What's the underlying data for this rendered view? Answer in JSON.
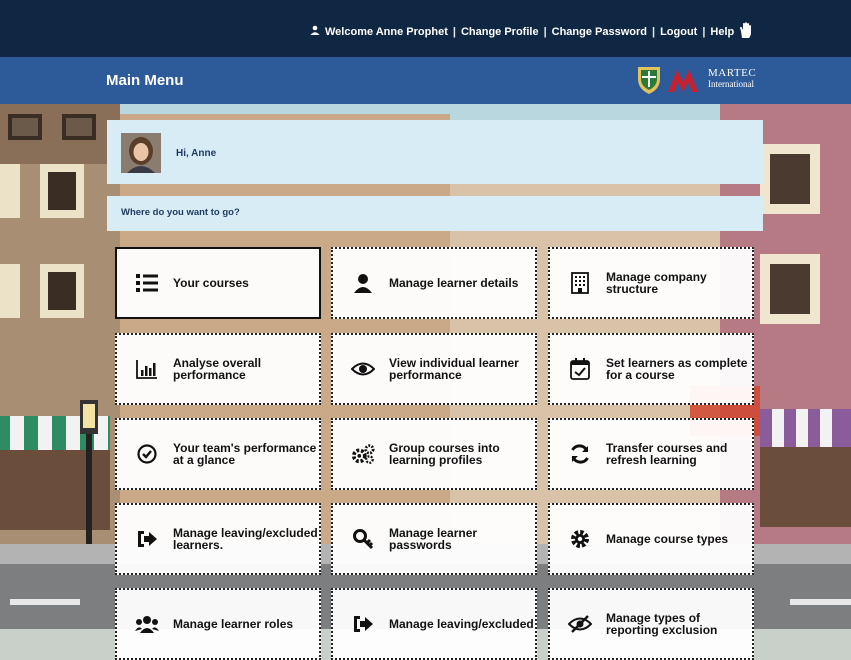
{
  "topbar": {
    "welcome": "Welcome Anne Prophet",
    "change_profile": "Change Profile",
    "change_password": "Change Password",
    "logout": "Logout",
    "help": "Help"
  },
  "header": {
    "title": "Main Menu",
    "brand_line1": "MARTEC",
    "brand_line2": "International"
  },
  "greeting": {
    "text": "Hi, Anne"
  },
  "prompt": {
    "text": "Where do you want to go?"
  },
  "tiles": [
    {
      "label": "Your courses",
      "icon": "list-icon"
    },
    {
      "label": "Manage learner details",
      "icon": "user-icon"
    },
    {
      "label": "Manage company structure",
      "icon": "building-icon"
    },
    {
      "label": "Analyse overall performance",
      "icon": "bar-chart-icon"
    },
    {
      "label": "View individual learner performance",
      "icon": "eye-icon"
    },
    {
      "label": "Set learners as complete for a course",
      "icon": "calendar-check-icon"
    },
    {
      "label": "Your team's performance at a glance",
      "icon": "check-circle-icon"
    },
    {
      "label": "Group courses into learning profiles",
      "icon": "gears-icon"
    },
    {
      "label": "Transfer courses and refresh learning",
      "icon": "refresh-icon"
    },
    {
      "label": "Manage leaving/excluded learners.",
      "icon": "exit-icon"
    },
    {
      "label": "Manage learner passwords",
      "icon": "key-icon"
    },
    {
      "label": "Manage course types",
      "icon": "gear-icon"
    },
    {
      "label": "Manage learner roles",
      "icon": "users-icon"
    },
    {
      "label": "Manage leaving/excluded",
      "icon": "exit-icon"
    },
    {
      "label": "Manage types of reporting exclusion",
      "icon": "eye-slash-icon"
    }
  ],
  "colors": {
    "topbar": "#0f2742",
    "header": "#2d5b99",
    "panel": "#d8ecf5"
  }
}
